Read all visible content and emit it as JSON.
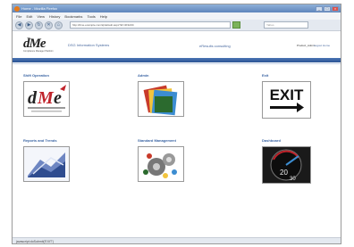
{
  "browser": {
    "title": "Home - Mozilla Firefox",
    "menu": [
      "File",
      "Edit",
      "View",
      "History",
      "Bookmarks",
      "Tools",
      "Help"
    ],
    "url": "http://dme.example.com/iq/default.aspx?id=4F3A9C",
    "search_placeholder": "Yahoo",
    "status": "javascript:doSubmit('EXIT')"
  },
  "header": {
    "logo_main": "dMe",
    "logo_tagline": "Compliance Manager Platform",
    "company": "DSG Information Systems",
    "slogan": "eResults consulting",
    "user": "Product_Admin",
    "links": "Logout Home"
  },
  "tiles": [
    {
      "label": "Shift Operation",
      "icon": "dme-logo-icon"
    },
    {
      "label": "Admin",
      "icon": "folders-icon"
    },
    {
      "label": "Exit",
      "icon": "exit-sign-icon",
      "exit_text": "EXIT"
    },
    {
      "label": "Reports and Trends",
      "icon": "chart-icon"
    },
    {
      "label": "Standard Management",
      "icon": "people-gears-icon"
    },
    {
      "label": "Dashboard",
      "icon": "speedometer-icon",
      "gauge_20": "20",
      "gauge_30": "30"
    }
  ]
}
